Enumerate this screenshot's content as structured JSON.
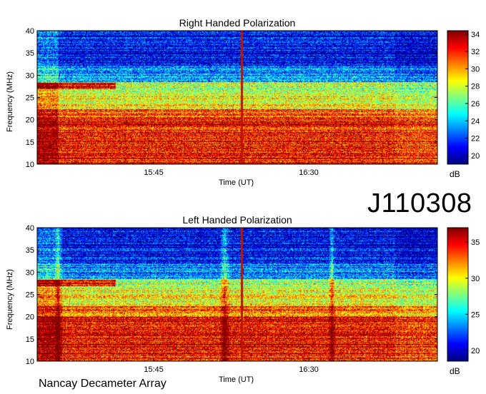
{
  "observation_id": "J110308",
  "footer": "Nancay Decameter Array",
  "chart_data": [
    {
      "type": "heatmap",
      "title": "Right Handed Polarization",
      "xlabel": "Time (UT)",
      "ylabel": "Frequency (MHz)",
      "x_ticks": [
        "15:45",
        "16:30"
      ],
      "y_ticks": [
        10,
        15,
        20,
        25,
        30,
        35,
        40
      ],
      "ylim": [
        10,
        40
      ],
      "colorbar": {
        "unit": "dB",
        "ticks": [
          20,
          22,
          24,
          26,
          28,
          30,
          32,
          34
        ],
        "range": [
          19,
          34.4
        ],
        "colormap": "jet"
      }
    },
    {
      "type": "heatmap",
      "title": "Left Handed Polarization",
      "xlabel": "Time (UT)",
      "ylabel": "Frequency (MHz)",
      "x_ticks": [
        "15:45",
        "16:30"
      ],
      "y_ticks": [
        10,
        15,
        20,
        25,
        30,
        35,
        40
      ],
      "ylim": [
        10,
        40
      ],
      "colorbar": {
        "unit": "dB",
        "ticks": [
          20,
          25,
          30,
          35
        ],
        "range": [
          18.5,
          37
        ],
        "colormap": "jet"
      }
    }
  ]
}
